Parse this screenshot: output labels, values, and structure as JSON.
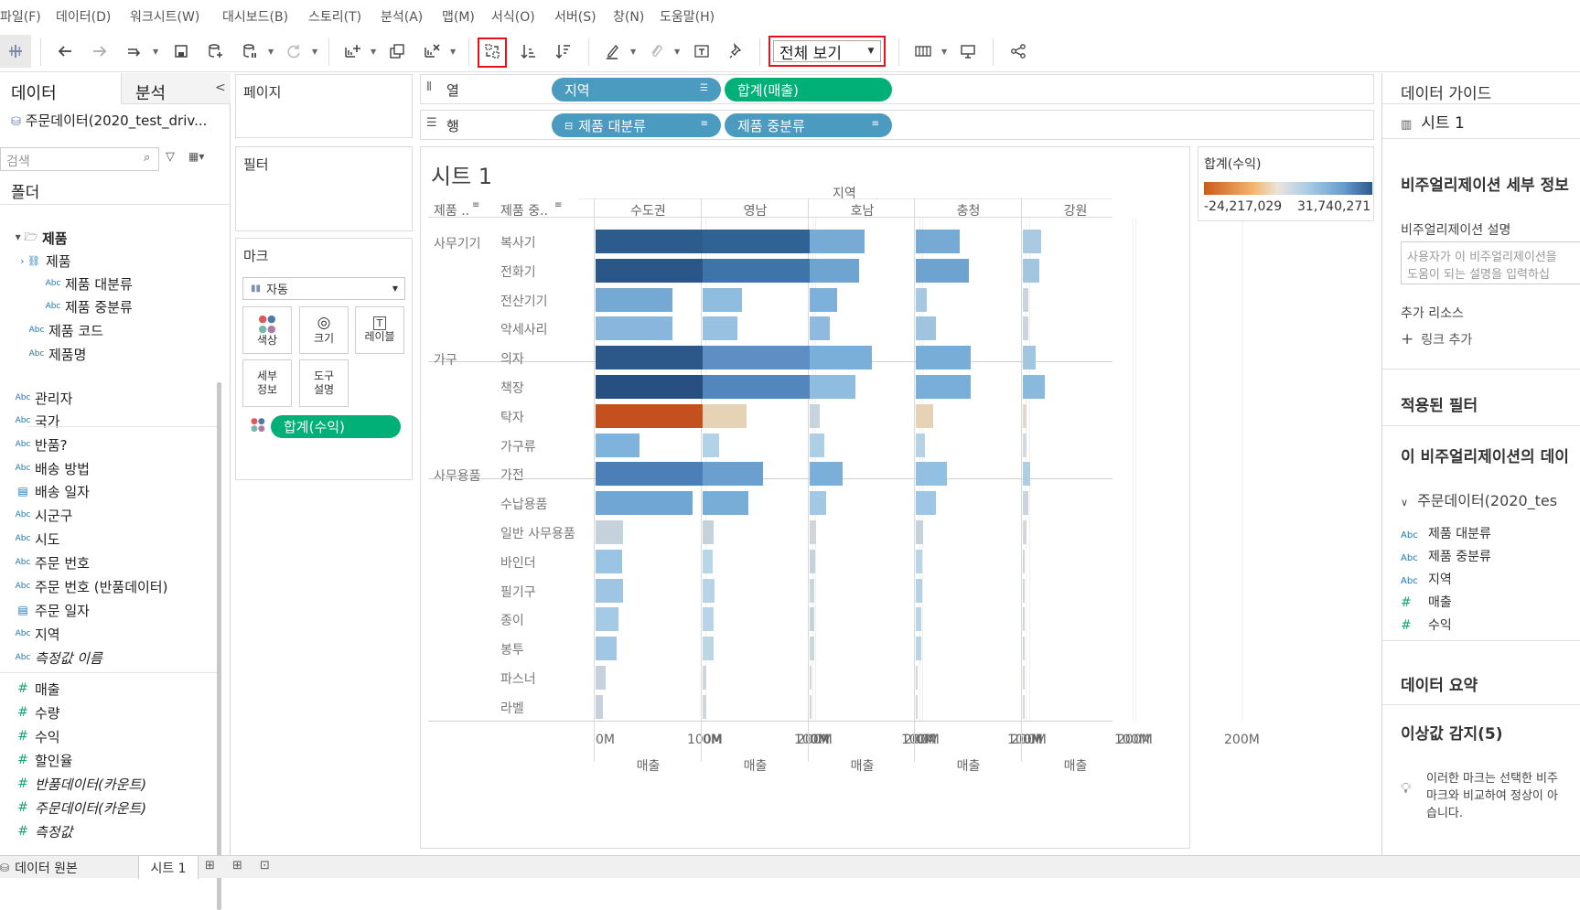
{
  "menu": [
    "파일(F)",
    "데이터(D)",
    "워크시트(W)",
    "대시보드(B)",
    "스토리(T)",
    "분석(A)",
    "맵(M)",
    "서식(O)",
    "서버(S)",
    "창(N)",
    "도움말(H)"
  ],
  "toolbar": {
    "view_mode": "전체 보기"
  },
  "left_panel": {
    "tab_data": "데이터",
    "tab_analysis": "분석",
    "collapse": "<",
    "datasource": "주문데이터(2020_test_driv...",
    "search_placeholder": "검색",
    "folder_label": "폴더",
    "fields": [
      {
        "label": "제품",
        "type": "folder"
      },
      {
        "label": "제품",
        "type": "hierarchy"
      },
      {
        "label": "제품 대분류",
        "type": "Abc"
      },
      {
        "label": "제품 중분류",
        "type": "Abc"
      },
      {
        "label": "제품 코드",
        "type": "Abc"
      },
      {
        "label": "제품명",
        "type": "Abc"
      },
      {
        "label": "관리자",
        "type": "Abc"
      },
      {
        "label": "국가",
        "type": "Abc"
      },
      {
        "label": "반품?",
        "type": "Abc"
      },
      {
        "label": "배송 방법",
        "type": "Abc"
      },
      {
        "label": "배송 일자",
        "type": "date"
      },
      {
        "label": "시군구",
        "type": "Abc"
      },
      {
        "label": "시도",
        "type": "Abc"
      },
      {
        "label": "주문 번호",
        "type": "Abc"
      },
      {
        "label": "주문 번호 (반품데이터)",
        "type": "Abc"
      },
      {
        "label": "주문 일자",
        "type": "date"
      },
      {
        "label": "지역",
        "type": "Abc"
      },
      {
        "label": "측정값 이름",
        "type": "Abc"
      },
      {
        "label": "매출",
        "type": "#"
      },
      {
        "label": "수량",
        "type": "#"
      },
      {
        "label": "수익",
        "type": "#"
      },
      {
        "label": "할인율",
        "type": "#"
      },
      {
        "label": "반품데이터(카운트)",
        "type": "#"
      },
      {
        "label": "주문데이터(카운트)",
        "type": "#"
      },
      {
        "label": "측정값",
        "type": "#"
      }
    ]
  },
  "shelves": {
    "pages": "페이지",
    "filters": "필터",
    "marks": "마크",
    "mark_type": "자동",
    "mark_buttons": [
      "색상",
      "크기",
      "레이블",
      "세부\n정보",
      "도구\n설명"
    ],
    "mark_pill": "합계(수익)",
    "columns_label": "열",
    "rows_label": "행",
    "columns_pills": [
      "지역",
      "합계(매출)"
    ],
    "rows_pills": [
      "제품 대분류",
      "제품 중분류"
    ]
  },
  "sheet": {
    "title": "시트 1",
    "row_header_1": "제품 ..",
    "row_header_2": "제품 중..",
    "region_title": "지역",
    "axis_title": "매출",
    "axis_ticks": [
      "0M",
      "100M",
      "200M"
    ]
  },
  "legend": {
    "title": "합계(수익)",
    "min": "-24,217,029",
    "max": "31,740,271"
  },
  "chart_data": {
    "type": "bar",
    "regions": [
      "수도권",
      "영남",
      "호남",
      "충청",
      "강원"
    ],
    "groups": [
      {
        "name": "사무기기",
        "items": [
          "복사기",
          "전화기",
          "전산기기",
          "악세사리"
        ]
      },
      {
        "name": "가구",
        "items": [
          "의자",
          "책장",
          "탁자",
          "가구류"
        ]
      },
      {
        "name": "사무용품",
        "items": [
          "가전",
          "수납용품",
          "일반 사무용품",
          "바인더",
          "필기구",
          "종이",
          "봉투",
          "파스너",
          "라벨"
        ]
      }
    ],
    "xlabel": "매출",
    "xlim": [
      0,
      240000000
    ],
    "sales": [
      [
        170000000,
        115000000,
        50000000,
        40000000,
        17000000
      ],
      [
        180000000,
        100000000,
        45000000,
        48000000,
        15000000
      ],
      [
        70000000,
        36000000,
        25000000,
        10000000,
        5000000
      ],
      [
        70000000,
        32000000,
        18000000,
        18000000,
        5000000
      ],
      [
        185000000,
        100000000,
        57000000,
        50000000,
        12000000
      ],
      [
        190000000,
        98000000,
        42000000,
        50000000,
        20000000
      ],
      [
        110000000,
        40000000,
        9000000,
        16000000,
        3000000
      ],
      [
        40000000,
        15000000,
        13000000,
        8000000,
        3000000
      ],
      [
        117000000,
        55000000,
        30000000,
        28000000,
        7000000
      ],
      [
        88000000,
        42000000,
        15000000,
        18000000,
        5000000
      ],
      [
        25000000,
        10000000,
        6000000,
        7000000,
        3000000
      ],
      [
        24000000,
        9000000,
        5000000,
        6000000,
        2000000
      ],
      [
        25000000,
        11000000,
        4000000,
        6000000,
        2000000
      ],
      [
        21000000,
        10000000,
        4000000,
        5000000,
        2000000
      ],
      [
        19000000,
        10000000,
        4000000,
        5000000,
        2000000
      ],
      [
        9000000,
        3000000,
        2000000,
        2000000,
        1000000
      ],
      [
        7000000,
        3000000,
        2000000,
        2000000,
        1000000
      ]
    ],
    "colors": [
      [
        "#2c5b8d",
        "#2f6396",
        "#77abd5",
        "#76aad4",
        "#a9cae2"
      ],
      [
        "#2a5688",
        "#3f74a8",
        "#6fa3d0",
        "#6ea3cf",
        "#a2c6e0"
      ],
      [
        "#74a9d3",
        "#8fbde0",
        "#7db0da",
        "#a6c8e2",
        "#c9d6dc"
      ],
      [
        "#88b6dd",
        "#97c0e1",
        "#8fb9de",
        "#9fc4e0",
        "#c9d6dc"
      ],
      [
        "#2b5889",
        "#5e8ec4",
        "#7aafd9",
        "#78add7",
        "#a2c6e0"
      ],
      [
        "#274f80",
        "#5486be",
        "#8ebde0",
        "#79aed8",
        "#8ab9de"
      ],
      [
        "#c4501f",
        "#e6d2b5",
        "#c6d5dd",
        "#e6d2b5",
        "#e2d8cc"
      ],
      [
        "#7fb3dc",
        "#b2d2e8",
        "#adcfe6",
        "#b6d2e4",
        "#d2dadf"
      ],
      [
        "#4c7fb8",
        "#6a9fcf",
        "#7aafd9",
        "#91c0e3",
        "#adcfe6"
      ],
      [
        "#6fa6d4",
        "#78add7",
        "#a2c8e6",
        "#9fc6e4",
        "#c9d6dc"
      ],
      [
        "#c6d2db",
        "#c6d2db",
        "#d0d5d8",
        "#c6d2db",
        "#d2d7db"
      ],
      [
        "#9ac4e3",
        "#b9d5e8",
        "#c6d2db",
        "#b9d5e8",
        "#c9d6dc"
      ],
      [
        "#9ec6e4",
        "#b7d3e6",
        "#c9d6dc",
        "#b5d2e5",
        "#c9d6dc"
      ],
      [
        "#a5cae5",
        "#b8d4e6",
        "#c6d2db",
        "#bad5e7",
        "#c9d6dc"
      ],
      [
        "#a1c7e4",
        "#bdd6e6",
        "#c9d6dc",
        "#bad5e7",
        "#c9d6dc"
      ],
      [
        "#c6d2db",
        "#d0d5d8",
        "#d0d5d8",
        "#d0d5d8",
        "#d2d7db"
      ],
      [
        "#c6d2db",
        "#d0d5d8",
        "#d0d5d8",
        "#d0d5d8",
        "#d2d7db"
      ]
    ]
  },
  "right_panel": {
    "title": "데이터 가이드",
    "sheet_name": "시트 1",
    "section_details": "비주얼리제이션 세부 정보",
    "desc_label": "비주얼리제이션 설명",
    "desc_placeholder_1": "사용자가 이 비주얼리제이션을",
    "desc_placeholder_2": "도움이 되는 설명을 입력하십",
    "resources_label": "추가 리소스",
    "add_link": "링크 추가",
    "applied_filters": "적용된 필터",
    "data_in_viz": "이 비주얼리제이션의 데이",
    "datasource": "주문데이터(2020_tes",
    "fields": [
      {
        "type": "Abc",
        "label": "제품 대분류"
      },
      {
        "type": "Abc",
        "label": "제품 중분류"
      },
      {
        "type": "Abc",
        "label": "지역"
      },
      {
        "type": "#",
        "label": "매출"
      },
      {
        "type": "#",
        "label": "수익"
      }
    ],
    "data_summary": "데이터 요약",
    "outliers": "이상값 감지(5)",
    "outlier_text_1": "이러한 마크는 선택한 비주",
    "outlier_text_2": "마크와 비교하여 정상이 아",
    "outlier_text_3": "습니다."
  },
  "status_bar": {
    "datasource_tab": "데이터 원본",
    "sheet_tab": "시트 1"
  }
}
